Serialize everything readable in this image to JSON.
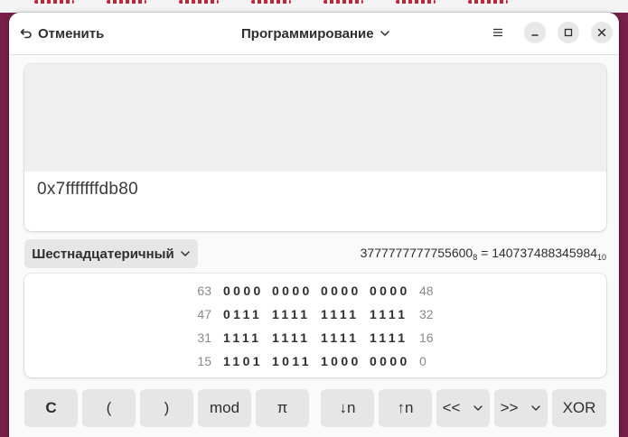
{
  "header": {
    "undo_label": "Отменить",
    "mode_label": "Программирование"
  },
  "display": {
    "expression": "0x7fffffffdb80"
  },
  "base": {
    "label": "Шестнадцатеричный"
  },
  "conversion": {
    "octal": "3777777777755600",
    "octal_sub": "8",
    "equals": " = ",
    "decimal": "140737488345984",
    "decimal_sub": "10"
  },
  "bits": {
    "rows": [
      {
        "left": "63",
        "nibbles": [
          "0000",
          "0000",
          "0000",
          "0000"
        ],
        "right": "48"
      },
      {
        "left": "47",
        "nibbles": [
          "0111",
          "1111",
          "1111",
          "1111"
        ],
        "right": "32"
      },
      {
        "left": "31",
        "nibbles": [
          "1111",
          "1111",
          "1111",
          "1111"
        ],
        "right": "16"
      },
      {
        "left": "15",
        "nibbles": [
          "1101",
          "1011",
          "1000",
          "0000"
        ],
        "right": "0"
      }
    ]
  },
  "keys": {
    "clear": "C",
    "open_paren": "(",
    "close_paren": ")",
    "mod": "mod",
    "pi": "π",
    "down_n": "↓n",
    "up_n": "↑n",
    "shift_left": "<<",
    "shift_right": ">>",
    "xor": "XOR"
  }
}
